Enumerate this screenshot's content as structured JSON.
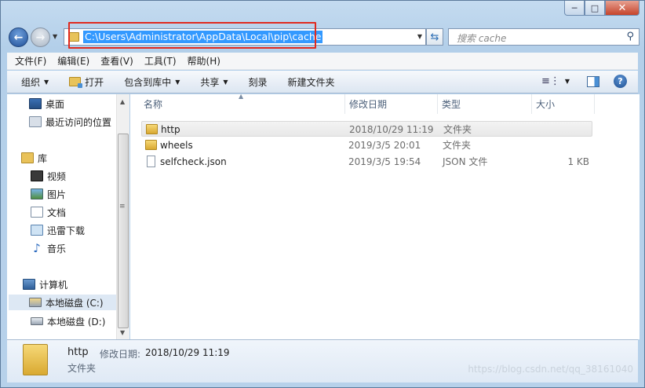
{
  "address": {
    "path": "C:\\Users\\Administrator\\AppData\\Local\\pip\\cache"
  },
  "search": {
    "placeholder": "搜索 cache"
  },
  "menu": [
    "文件(F)",
    "编辑(E)",
    "查看(V)",
    "工具(T)",
    "帮助(H)"
  ],
  "commands": {
    "organize": "组织",
    "open": "打开",
    "include": "包含到库中",
    "share": "共享",
    "burn": "刻录",
    "new_folder": "新建文件夹"
  },
  "sidebar": {
    "desktop": "桌面",
    "recent": "最近访问的位置",
    "libraries": "库",
    "videos": "视频",
    "pictures": "图片",
    "documents": "文档",
    "thunder": "迅雷下载",
    "music": "音乐",
    "computer": "计算机",
    "drive_c": "本地磁盘 (C:)",
    "drive_d": "本地磁盘 (D:)"
  },
  "columns": {
    "name": "名称",
    "date": "修改日期",
    "type": "类型",
    "size": "大小"
  },
  "files": [
    {
      "name": "http",
      "date": "2018/10/29 11:19",
      "type": "文件夹",
      "size": ""
    },
    {
      "name": "wheels",
      "date": "2019/3/5 20:01",
      "type": "文件夹",
      "size": ""
    },
    {
      "name": "selfcheck.json",
      "date": "2019/3/5 19:54",
      "type": "JSON 文件",
      "size": "1 KB"
    }
  ],
  "details": {
    "name": "http",
    "modified_label": "修改日期:",
    "modified_value": "2018/10/29 11:19",
    "type": "文件夹"
  },
  "watermark": "https://blog.csdn.net/qq_38161040",
  "colors": {
    "selection": "#3399ff",
    "highlight_box": "#e02a1f"
  }
}
